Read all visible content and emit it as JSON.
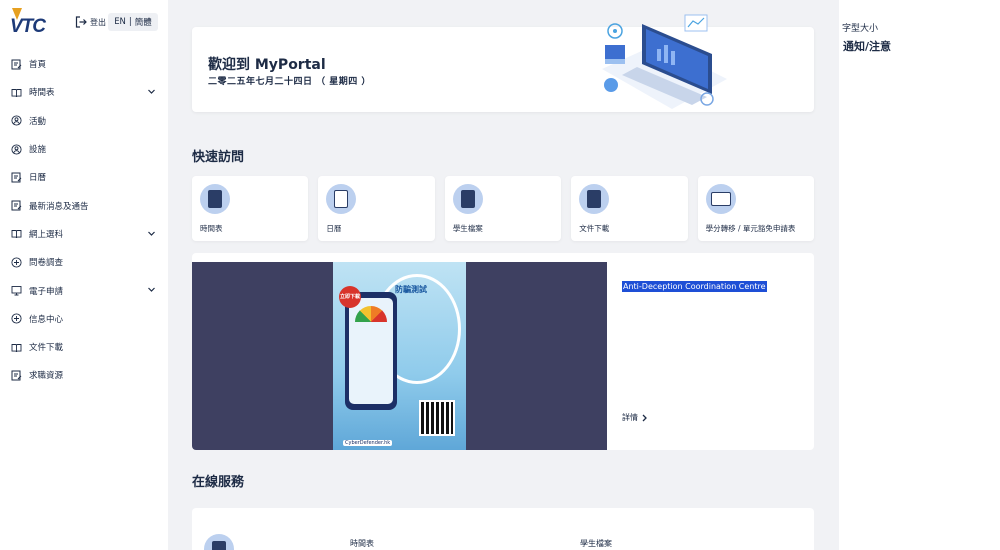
{
  "header": {
    "logo_text": "VTC",
    "logout_label": "登出",
    "lang_en": "EN",
    "lang_sep": "|",
    "lang_sc": "簡體"
  },
  "sidebar": {
    "items": [
      {
        "label": "首頁",
        "icon": "edit-doc-icon",
        "expandable": false
      },
      {
        "label": "時間表",
        "icon": "book-icon",
        "expandable": true
      },
      {
        "label": "活動",
        "icon": "user-circle-icon",
        "expandable": false
      },
      {
        "label": "設施",
        "icon": "user-circle-icon",
        "expandable": false
      },
      {
        "label": "日曆",
        "icon": "edit-doc-icon",
        "expandable": false
      },
      {
        "label": "最新消息及通告",
        "icon": "edit-doc-icon",
        "expandable": false
      },
      {
        "label": "網上選科",
        "icon": "book-icon",
        "expandable": true
      },
      {
        "label": "問卷調查",
        "icon": "plus-circle-icon",
        "expandable": false
      },
      {
        "label": "電子申請",
        "icon": "monitor-icon",
        "expandable": true
      },
      {
        "label": "信息中心",
        "icon": "plus-circle-icon",
        "expandable": false
      },
      {
        "label": "文件下載",
        "icon": "book-icon",
        "expandable": false
      },
      {
        "label": "求職資源",
        "icon": "edit-doc-icon",
        "expandable": false
      }
    ]
  },
  "welcome": {
    "title": "歡迎到 MyPortal",
    "date": "二零二五年七月二十四日 （ 星期四 ）"
  },
  "quick_access": {
    "title": "快速訪問",
    "items": [
      {
        "label": "時間表",
        "icon": "book-icon"
      },
      {
        "label": "日曆",
        "icon": "list-icon"
      },
      {
        "label": "學生檔案",
        "icon": "book-icon"
      },
      {
        "label": "文件下載",
        "icon": "book-icon"
      },
      {
        "label": "學分轉移 / 單元豁免申請表",
        "icon": "monitor-icon"
      }
    ]
  },
  "banner": {
    "title": "Anti-Deception Coordination Centre",
    "more_label": "詳情",
    "poster_heading": "防騙測試",
    "poster_badge": "立即下載",
    "poster_footer": "CyberDefender.hk"
  },
  "online_services": {
    "title": "在線服務",
    "items": [
      {
        "label": "時間表"
      },
      {
        "label": "學生檔案"
      }
    ]
  },
  "right_panel": {
    "font_size_label": "字型大小",
    "notice_label": "通知/注意"
  },
  "colors": {
    "primary_text": "#1d2b45",
    "main_bg": "#f1f2f5",
    "icon_circle": "#bcd0ef",
    "banner_dark": "#3e4061",
    "highlight": "#1e4fd6"
  }
}
